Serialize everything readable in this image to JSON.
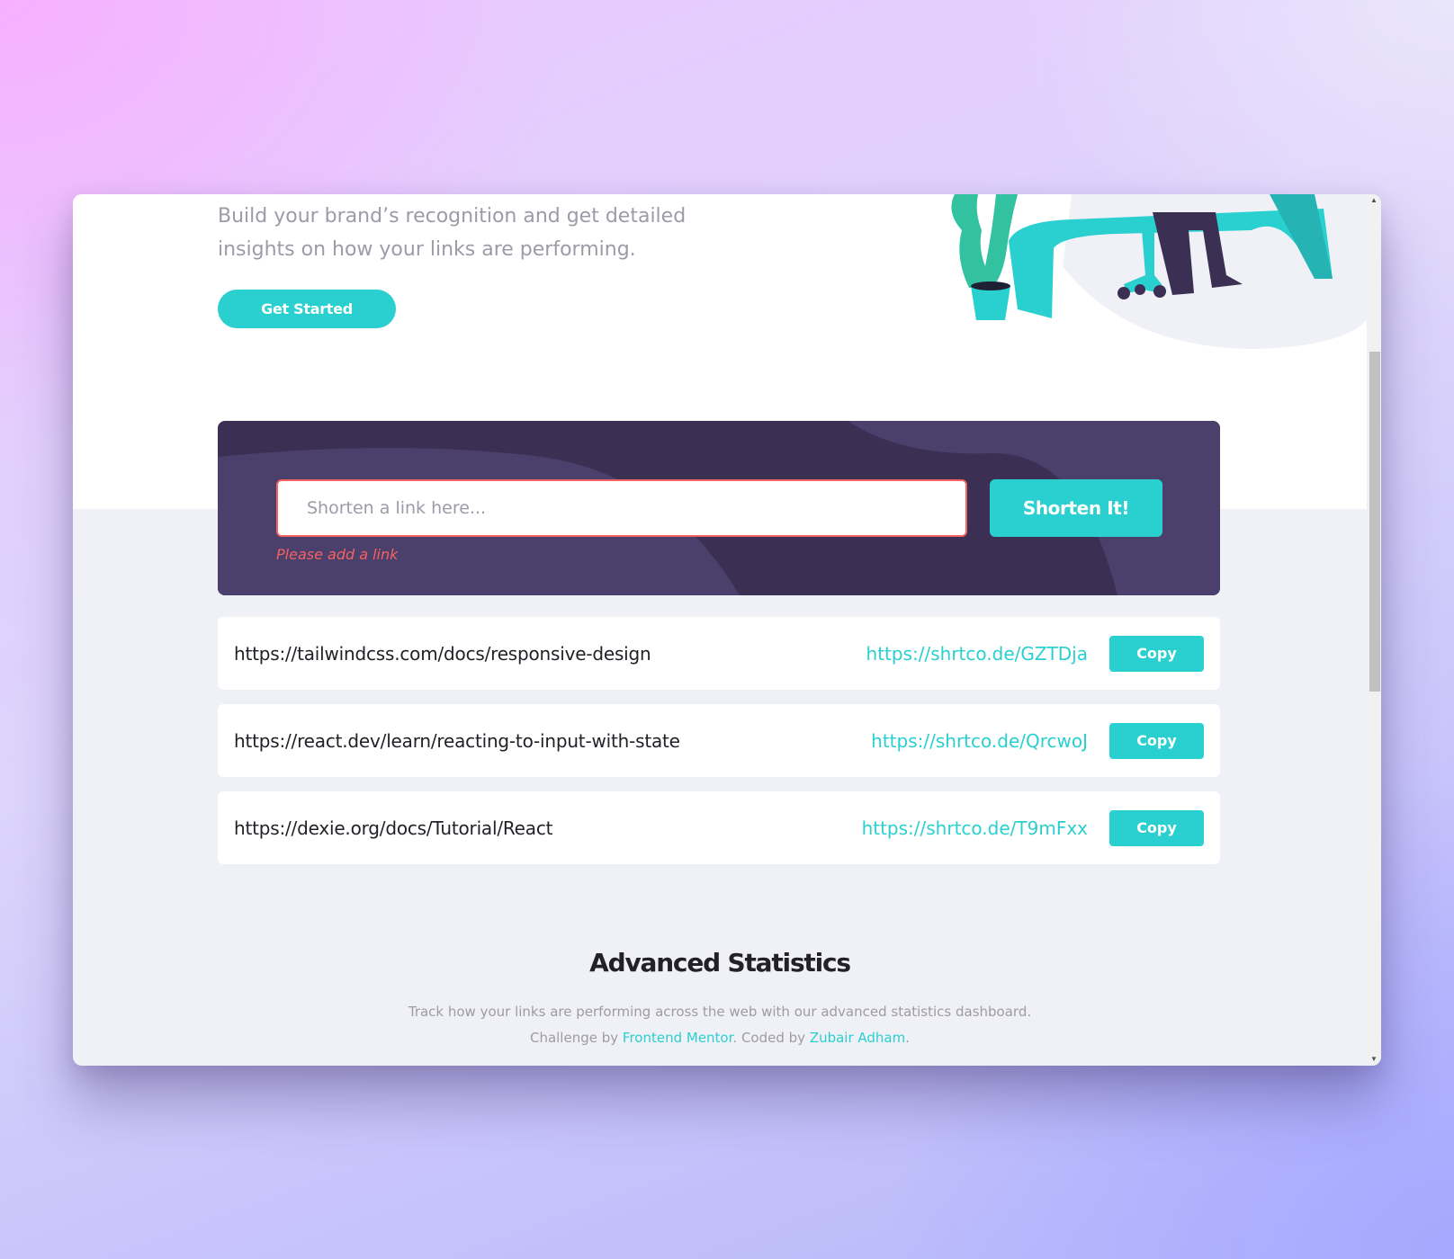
{
  "hero": {
    "description": "Build your brand’s recognition and get detailed insights on how your links are performing.",
    "cta_label": "Get Started"
  },
  "shorten": {
    "placeholder": "Shorten a link here...",
    "error": "Please add a link",
    "button_label": "Shorten It!"
  },
  "results": [
    {
      "original": "https://tailwindcss.com/docs/responsive-design",
      "short": "https://shrtco.de/GZTDja",
      "copy_label": "Copy"
    },
    {
      "original": "https://react.dev/learn/reacting-to-input-with-state",
      "short": "https://shrtco.de/QrcwoJ",
      "copy_label": "Copy"
    },
    {
      "original": "https://dexie.org/docs/Tutorial/React",
      "short": "https://shrtco.de/T9mFxx",
      "copy_label": "Copy"
    }
  ],
  "statistics": {
    "title": "Advanced Statistics",
    "description": "Track how your links are performing across the web with our advanced statistics dashboard."
  },
  "attribution": {
    "prefix": "Challenge by ",
    "link1": "Frontend Mentor",
    "middle": ". Coded by ",
    "link2": "Zubair Adham",
    "suffix": "."
  },
  "colors": {
    "cyan": "#2acfcf",
    "dark_violet": "#3b3054",
    "red": "#f46262",
    "gray": "#9e9aa8",
    "very_dark": "#232127"
  },
  "icons": {
    "scroll_up": "▲",
    "scroll_down": "▼"
  }
}
